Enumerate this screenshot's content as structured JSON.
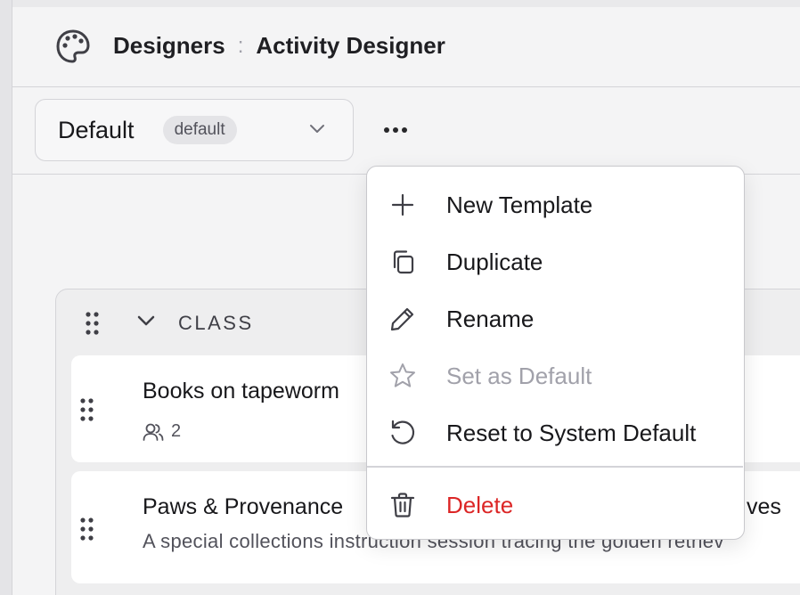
{
  "header": {
    "breadcrumb_root": "Designers",
    "breadcrumb_separator": ":",
    "breadcrumb_current": "Activity Designer"
  },
  "toolbar": {
    "template_name": "Default",
    "template_badge": "default"
  },
  "section": {
    "title": "CLASS",
    "cards": [
      {
        "title": "Books on tapeworm",
        "participants": "2"
      },
      {
        "title": "Paws & Provenance",
        "title_tail": "ves",
        "description": "A special collections instruction session tracing the golden retriev"
      }
    ]
  },
  "menu": {
    "items": [
      {
        "label": "New Template",
        "icon": "plus-icon",
        "disabled": false
      },
      {
        "label": "Duplicate",
        "icon": "copy-icon",
        "disabled": false
      },
      {
        "label": "Rename",
        "icon": "pencil-icon",
        "disabled": false
      },
      {
        "label": "Set as Default",
        "icon": "star-icon",
        "disabled": true
      },
      {
        "label": "Reset to System Default",
        "icon": "reset-icon",
        "disabled": false
      }
    ],
    "delete_label": "Delete"
  },
  "colors": {
    "danger": "#dc2626",
    "disabled_text": "#a1a1aa",
    "badge_bg": "#e4e4e7"
  }
}
